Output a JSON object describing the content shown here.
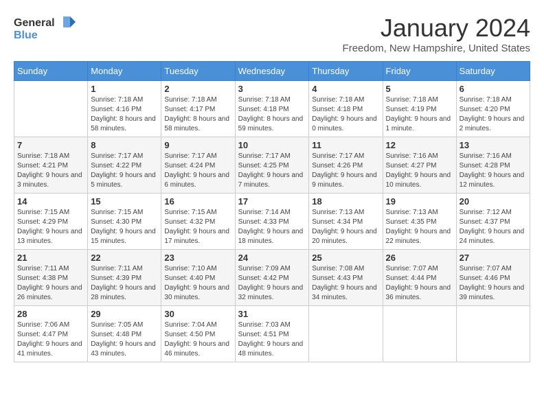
{
  "logo": {
    "general": "General",
    "blue": "Blue"
  },
  "title": "January 2024",
  "subtitle": "Freedom, New Hampshire, United States",
  "headers": [
    "Sunday",
    "Monday",
    "Tuesday",
    "Wednesday",
    "Thursday",
    "Friday",
    "Saturday"
  ],
  "weeks": [
    [
      {
        "day": "",
        "sunrise": "",
        "sunset": "",
        "daylight": ""
      },
      {
        "day": "1",
        "sunrise": "Sunrise: 7:18 AM",
        "sunset": "Sunset: 4:16 PM",
        "daylight": "Daylight: 8 hours and 58 minutes."
      },
      {
        "day": "2",
        "sunrise": "Sunrise: 7:18 AM",
        "sunset": "Sunset: 4:17 PM",
        "daylight": "Daylight: 8 hours and 58 minutes."
      },
      {
        "day": "3",
        "sunrise": "Sunrise: 7:18 AM",
        "sunset": "Sunset: 4:18 PM",
        "daylight": "Daylight: 8 hours and 59 minutes."
      },
      {
        "day": "4",
        "sunrise": "Sunrise: 7:18 AM",
        "sunset": "Sunset: 4:18 PM",
        "daylight": "Daylight: 9 hours and 0 minutes."
      },
      {
        "day": "5",
        "sunrise": "Sunrise: 7:18 AM",
        "sunset": "Sunset: 4:19 PM",
        "daylight": "Daylight: 9 hours and 1 minute."
      },
      {
        "day": "6",
        "sunrise": "Sunrise: 7:18 AM",
        "sunset": "Sunset: 4:20 PM",
        "daylight": "Daylight: 9 hours and 2 minutes."
      }
    ],
    [
      {
        "day": "7",
        "sunrise": "Sunrise: 7:18 AM",
        "sunset": "Sunset: 4:21 PM",
        "daylight": "Daylight: 9 hours and 3 minutes."
      },
      {
        "day": "8",
        "sunrise": "Sunrise: 7:17 AM",
        "sunset": "Sunset: 4:22 PM",
        "daylight": "Daylight: 9 hours and 5 minutes."
      },
      {
        "day": "9",
        "sunrise": "Sunrise: 7:17 AM",
        "sunset": "Sunset: 4:24 PM",
        "daylight": "Daylight: 9 hours and 6 minutes."
      },
      {
        "day": "10",
        "sunrise": "Sunrise: 7:17 AM",
        "sunset": "Sunset: 4:25 PM",
        "daylight": "Daylight: 9 hours and 7 minutes."
      },
      {
        "day": "11",
        "sunrise": "Sunrise: 7:17 AM",
        "sunset": "Sunset: 4:26 PM",
        "daylight": "Daylight: 9 hours and 9 minutes."
      },
      {
        "day": "12",
        "sunrise": "Sunrise: 7:16 AM",
        "sunset": "Sunset: 4:27 PM",
        "daylight": "Daylight: 9 hours and 10 minutes."
      },
      {
        "day": "13",
        "sunrise": "Sunrise: 7:16 AM",
        "sunset": "Sunset: 4:28 PM",
        "daylight": "Daylight: 9 hours and 12 minutes."
      }
    ],
    [
      {
        "day": "14",
        "sunrise": "Sunrise: 7:15 AM",
        "sunset": "Sunset: 4:29 PM",
        "daylight": "Daylight: 9 hours and 13 minutes."
      },
      {
        "day": "15",
        "sunrise": "Sunrise: 7:15 AM",
        "sunset": "Sunset: 4:30 PM",
        "daylight": "Daylight: 9 hours and 15 minutes."
      },
      {
        "day": "16",
        "sunrise": "Sunrise: 7:15 AM",
        "sunset": "Sunset: 4:32 PM",
        "daylight": "Daylight: 9 hours and 17 minutes."
      },
      {
        "day": "17",
        "sunrise": "Sunrise: 7:14 AM",
        "sunset": "Sunset: 4:33 PM",
        "daylight": "Daylight: 9 hours and 18 minutes."
      },
      {
        "day": "18",
        "sunrise": "Sunrise: 7:13 AM",
        "sunset": "Sunset: 4:34 PM",
        "daylight": "Daylight: 9 hours and 20 minutes."
      },
      {
        "day": "19",
        "sunrise": "Sunrise: 7:13 AM",
        "sunset": "Sunset: 4:35 PM",
        "daylight": "Daylight: 9 hours and 22 minutes."
      },
      {
        "day": "20",
        "sunrise": "Sunrise: 7:12 AM",
        "sunset": "Sunset: 4:37 PM",
        "daylight": "Daylight: 9 hours and 24 minutes."
      }
    ],
    [
      {
        "day": "21",
        "sunrise": "Sunrise: 7:11 AM",
        "sunset": "Sunset: 4:38 PM",
        "daylight": "Daylight: 9 hours and 26 minutes."
      },
      {
        "day": "22",
        "sunrise": "Sunrise: 7:11 AM",
        "sunset": "Sunset: 4:39 PM",
        "daylight": "Daylight: 9 hours and 28 minutes."
      },
      {
        "day": "23",
        "sunrise": "Sunrise: 7:10 AM",
        "sunset": "Sunset: 4:40 PM",
        "daylight": "Daylight: 9 hours and 30 minutes."
      },
      {
        "day": "24",
        "sunrise": "Sunrise: 7:09 AM",
        "sunset": "Sunset: 4:42 PM",
        "daylight": "Daylight: 9 hours and 32 minutes."
      },
      {
        "day": "25",
        "sunrise": "Sunrise: 7:08 AM",
        "sunset": "Sunset: 4:43 PM",
        "daylight": "Daylight: 9 hours and 34 minutes."
      },
      {
        "day": "26",
        "sunrise": "Sunrise: 7:07 AM",
        "sunset": "Sunset: 4:44 PM",
        "daylight": "Daylight: 9 hours and 36 minutes."
      },
      {
        "day": "27",
        "sunrise": "Sunrise: 7:07 AM",
        "sunset": "Sunset: 4:46 PM",
        "daylight": "Daylight: 9 hours and 39 minutes."
      }
    ],
    [
      {
        "day": "28",
        "sunrise": "Sunrise: 7:06 AM",
        "sunset": "Sunset: 4:47 PM",
        "daylight": "Daylight: 9 hours and 41 minutes."
      },
      {
        "day": "29",
        "sunrise": "Sunrise: 7:05 AM",
        "sunset": "Sunset: 4:48 PM",
        "daylight": "Daylight: 9 hours and 43 minutes."
      },
      {
        "day": "30",
        "sunrise": "Sunrise: 7:04 AM",
        "sunset": "Sunset: 4:50 PM",
        "daylight": "Daylight: 9 hours and 46 minutes."
      },
      {
        "day": "31",
        "sunrise": "Sunrise: 7:03 AM",
        "sunset": "Sunset: 4:51 PM",
        "daylight": "Daylight: 9 hours and 48 minutes."
      },
      {
        "day": "",
        "sunrise": "",
        "sunset": "",
        "daylight": ""
      },
      {
        "day": "",
        "sunrise": "",
        "sunset": "",
        "daylight": ""
      },
      {
        "day": "",
        "sunrise": "",
        "sunset": "",
        "daylight": ""
      }
    ]
  ]
}
